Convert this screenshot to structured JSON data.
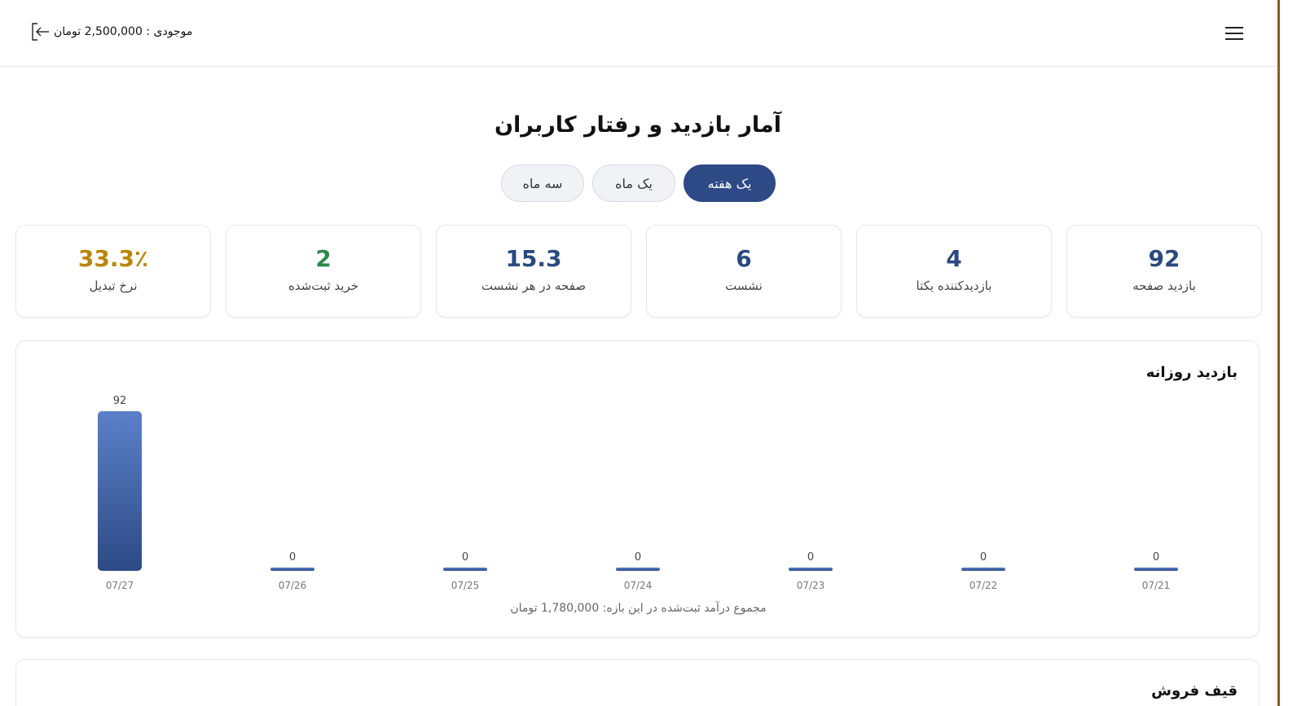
{
  "header": {
    "balance_text": "موجودی : 2,500,000 تومان",
    "logout_icon": "logout-icon",
    "menu_icon": "hamburger-menu-icon"
  },
  "page": {
    "title": "آمار بازدید و رفتار کاربران"
  },
  "range_tabs": [
    {
      "label": "سه ماه",
      "active": false
    },
    {
      "label": "یک ماه",
      "active": false
    },
    {
      "label": "یک هفته",
      "active": true
    }
  ],
  "stats": [
    {
      "value": "33.3٪",
      "label": "نرخ تبدیل",
      "color": "#b8860b"
    },
    {
      "value": "2",
      "label": "خرید ثبت‌شده",
      "color": "#2a8a4a"
    },
    {
      "value": "15.3",
      "label": "صفحه در هر نشست",
      "color": "#2a4a80"
    },
    {
      "value": "6",
      "label": "نشست",
      "color": "#2a4a80"
    },
    {
      "value": "4",
      "label": "بازدیدکننده یکتا",
      "color": "#2a4a80"
    },
    {
      "value": "92",
      "label": "بازدید صفحه",
      "color": "#2a4a80"
    }
  ],
  "daily_chart": {
    "title": "بازدید روزانه",
    "footer": "مجموع درآمد ثبت‌شده در این بازه: 1,780,000 تومان"
  },
  "chart_data": {
    "type": "bar",
    "title": "بازدید روزانه",
    "categories": [
      "07/27",
      "07/26",
      "07/25",
      "07/24",
      "07/23",
      "07/22",
      "07/21"
    ],
    "values": [
      92,
      0,
      0,
      0,
      0,
      0,
      0
    ],
    "bar_color": "#3f63a8",
    "ylim": [
      0,
      92
    ],
    "grid": false
  },
  "funnel": {
    "title": "قیف فروش"
  },
  "colors": {
    "accent": "#2d4a86",
    "scroll_rail": "#8b5a2b"
  }
}
